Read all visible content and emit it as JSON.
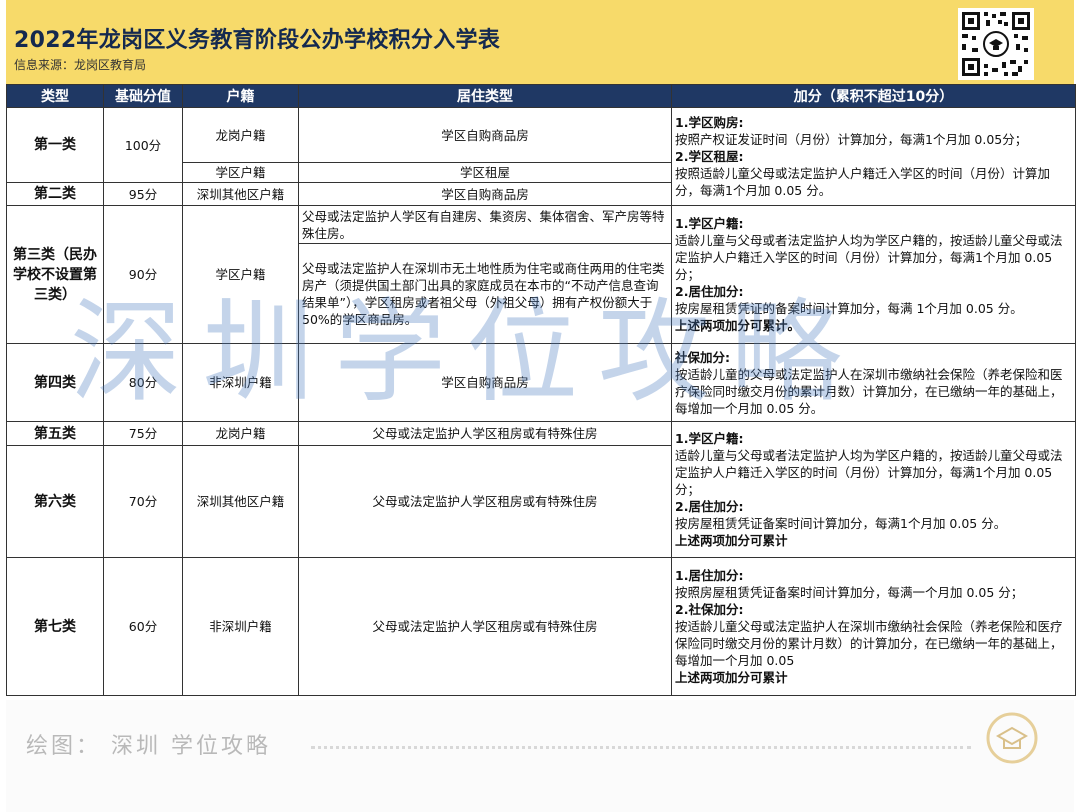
{
  "header": {
    "title": "2022年龙岗区义务教育阶段公办学校积分入学表",
    "source": "信息来源：龙岗区教育局"
  },
  "table": {
    "headers": [
      "类型",
      "基础分值",
      "户籍",
      "居住类型",
      "加分（累积不超过10分）"
    ],
    "rows": {
      "r1": {
        "category": "第一类",
        "score": "100分",
        "huji_a": "龙岗户籍",
        "huji_b": "学区户籍",
        "residence_a": "学区自购商品房",
        "residence_b": "学区租屋"
      },
      "r2": {
        "category": "第二类",
        "score": "95分",
        "huji": "深圳其他区户籍",
        "residence": "学区自购商品房"
      },
      "r3": {
        "category": "第三类（民办学校不设置第三类）",
        "score": "90分",
        "huji": "学区户籍",
        "residence_a": "父母或法定监护人学区有自建房、集资房、集体宿舍、军产房等特殊住房。",
        "residence_b": "父母或法定监护人在深圳市无土地性质为住宅或商住两用的住宅类房产（须提供国土部门出具的家庭成员在本市的“不动产信息查询结果单”），学区租房或者祖父母（外祖父母）拥有产权份额大于50%的学区商品房。"
      },
      "r4": {
        "category": "第四类",
        "score": "80分",
        "huji": "非深圳户籍",
        "residence": "学区自购商品房"
      },
      "r5": {
        "category": "第五类",
        "score": "75分",
        "huji": "龙岗户籍",
        "residence": "父母或法定监护人学区租房或有特殊住房"
      },
      "r6": {
        "category": "第六类",
        "score": "70分",
        "huji": "深圳其他区户籍",
        "residence": "父母或法定监护人学区租房或有特殊住房"
      },
      "r7": {
        "category": "第七类",
        "score": "60分",
        "huji": "非深圳户籍",
        "residence": "父母或法定监护人学区租房或有特殊住房"
      }
    },
    "bonus": {
      "b1": {
        "h1": "1.学区购房:",
        "t1": "按照产权证发证时间（月份）计算加分，每满1个月加 0.05分；",
        "h2": "2.学区租屋:",
        "t2": "按照适龄儿童父母或法定监护人户籍迁入学区的时间（月份）计算加分，每满1个月加 0.05 分。"
      },
      "b3": {
        "h1": "1.学区户籍:",
        "t1": "适龄儿童与父母或者法定监护人均为学区户籍的，按适龄儿童父母或法定监护人户籍迁入学区的时间（月份）计算加分，每满1个月加 0.05 分；",
        "h2": "2.居住加分:",
        "t2": "按房屋租赁凭证的备案时间计算加分，每满 1个月加 0.05 分。",
        "note": "上述两项加分可累计。"
      },
      "b4": {
        "h1": "社保加分:",
        "t1": "按适龄儿童的父母或法定监护人在深圳市缴纳社会保险（养老保险和医疗保险同时缴交月份的累计月数）计算加分，在已缴纳一年的基础上，每增加一个月加 0.05 分。"
      },
      "b5": {
        "h1": "1.学区户籍:",
        "t1": "适龄儿童与父母或者法定监护人均为学区户籍的，按适龄儿童父母或法定监护人户籍迁入学区的时间（月份）计算加分，每满1个月加 0.05 分；",
        "h2": "2.居住加分:",
        "t2": "按房屋租赁凭证备案时间计算加分，每满1个月加 0.05 分。",
        "note": "上述两项加分可累计"
      },
      "b7": {
        "h1": "1.居住加分:",
        "t1": "按照房屋租赁凭证备案时间计算加分，每满一个月加 0.05 分；",
        "h2": "2.社保加分:",
        "t2": "按适龄儿童父母或法定监护人在深圳市缴纳社会保险（养老保险和医疗保险同时缴交月份的累计月数）的计算加分，在已缴纳一年的基础上，每增加一个月加 0.05",
        "note": "上述两项加分可累计"
      }
    }
  },
  "watermark": "深圳学位攻略",
  "footer": {
    "text": "绘图：  深圳 学位攻略"
  },
  "colors": {
    "header_bg": "#f7da6a",
    "table_header_bg": "#1f3864",
    "title_color": "#14294f",
    "watermark": "#4678be"
  }
}
